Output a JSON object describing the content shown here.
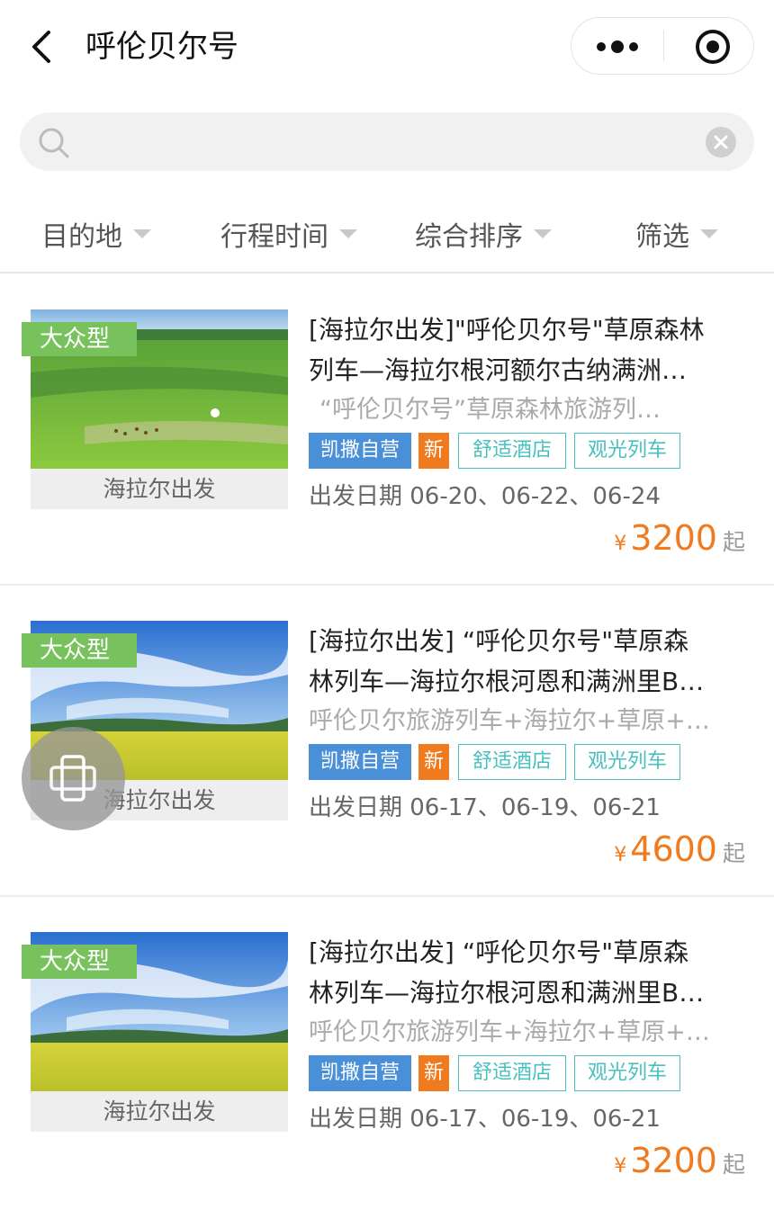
{
  "header": {
    "title": "呼伦贝尔号"
  },
  "search": {
    "value": "",
    "placeholder": ""
  },
  "filters": [
    "目的地",
    "行程时间",
    "综合排序",
    "筛选"
  ],
  "cards": [
    {
      "type_badge": "大众型",
      "depart_caption": "海拉尔出发",
      "title_line1": "[海拉尔出发]\"呼伦贝尔号\"草原森林",
      "title_line2": "列车—海拉尔根河额尔古纳满洲…",
      "subtitle": "“呼伦贝尔号”草原森林旅游列…",
      "tags": [
        "凯撒自营",
        "新",
        "舒适酒店",
        "观光列车"
      ],
      "dates": "出发日期 06-20、06-22、06-24",
      "currency": "¥",
      "price": "3200",
      "price_suffix": "起"
    },
    {
      "type_badge": "大众型",
      "depart_caption": "海拉尔出发",
      "title_line1": "[海拉尔出发] “呼伦贝尔号\"草原森",
      "title_line2": "林列车—海拉尔根河恩和满洲里B…",
      "subtitle": "呼伦贝尔旅游列车+海拉尔+草原+…",
      "tags": [
        "凯撒自营",
        "新",
        "舒适酒店",
        "观光列车"
      ],
      "dates": "出发日期 06-17、06-19、06-21",
      "currency": "¥",
      "price": "4600",
      "price_suffix": "起"
    },
    {
      "type_badge": "大众型",
      "depart_caption": "海拉尔出发",
      "title_line1": "[海拉尔出发] “呼伦贝尔号\"草原森",
      "title_line2": "林列车—海拉尔根河恩和满洲里B…",
      "subtitle": "呼伦贝尔旅游列车+海拉尔+草原+…",
      "tags": [
        "凯撒自营",
        "新",
        "舒适酒店",
        "观光列车"
      ],
      "dates": "出发日期 06-17、06-19、06-21",
      "currency": "¥",
      "price": "3200",
      "price_suffix": "起"
    }
  ],
  "colors": {
    "accent": "#f07a1e",
    "self_tag": "#4a90d9",
    "badge_green": "#78c25e",
    "outline_tag": "#49c0c0"
  },
  "icons": [
    "back-icon",
    "more-dots-icon",
    "close-target-icon",
    "search-icon",
    "clear-icon",
    "caret-down-icon",
    "rotate-screen-icon"
  ]
}
